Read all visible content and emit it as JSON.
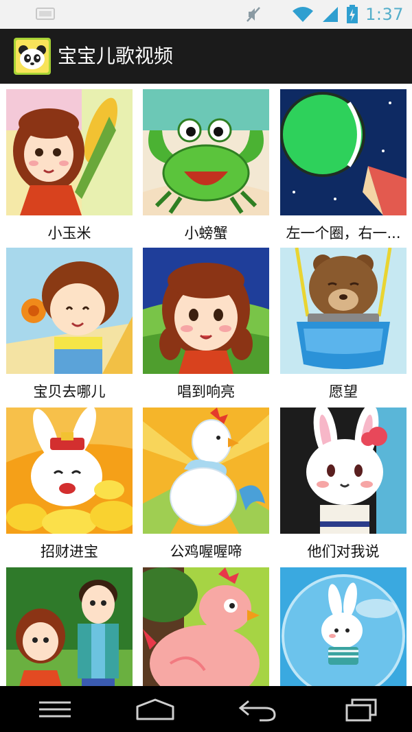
{
  "status_bar": {
    "time": "1:37",
    "icons": [
      "screenshot-icon",
      "mute-icon",
      "wifi-icon",
      "signal-icon",
      "battery-charging-icon"
    ]
  },
  "app_bar": {
    "title": "宝宝儿歌视频",
    "icon": "panda-app-icon"
  },
  "videos": [
    {
      "title": "小玉米",
      "thumb": "girl-with-corn"
    },
    {
      "title": "小螃蟹",
      "thumb": "green-crab"
    },
    {
      "title": "左一个圈，右一...",
      "thumb": "green-ball-and-pencil"
    },
    {
      "title": "宝贝去哪儿",
      "thumb": "boy-with-flower"
    },
    {
      "title": "唱到响亮",
      "thumb": "girl-with-pigtails"
    },
    {
      "title": "愿望",
      "thumb": "bear-in-balloon"
    },
    {
      "title": "招财进宝",
      "thumb": "rabbit-with-gold"
    },
    {
      "title": "公鸡喔喔啼",
      "thumb": "white-rooster"
    },
    {
      "title": "他们对我说",
      "thumb": "rabbit-with-bow"
    },
    {
      "title": "",
      "thumb": "two-children"
    },
    {
      "title": "",
      "thumb": "pink-hen"
    },
    {
      "title": "",
      "thumb": "rabbit-in-bubble"
    }
  ],
  "nav_bar": {
    "buttons": [
      "menu-icon",
      "home-icon",
      "back-icon",
      "recents-icon"
    ]
  },
  "colors": {
    "action_bar": "#1b1b1b",
    "status_bar": "#f2f2f2",
    "clock": "#54aeca",
    "nav_bar": "#000000"
  }
}
